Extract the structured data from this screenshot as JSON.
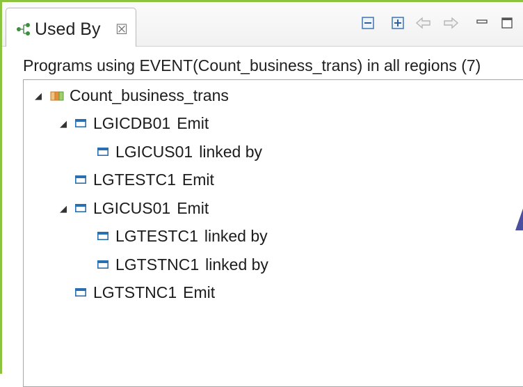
{
  "tab": {
    "icon": "hierarchy-icon",
    "label": "Used By",
    "close_icon": "close-icon",
    "close_glyph": "☒"
  },
  "toolbar": [
    {
      "icon": "collapse-all-icon"
    },
    {
      "icon": "expand-all-icon"
    },
    {
      "icon": "back-arrow-icon"
    },
    {
      "icon": "forward-arrow-icon"
    },
    {
      "icon": "minimize-icon"
    },
    {
      "icon": "maximize-icon"
    }
  ],
  "header": "Programs using EVENT(Count_business_trans) in all regions (7)",
  "tree": {
    "root": {
      "label": "Count_business_trans",
      "icon": "event-icon",
      "expanded": true
    },
    "nodes": [
      {
        "name": "LGICDB01",
        "relation": "Emit",
        "level": 1,
        "expanded": true
      },
      {
        "name": "LGICUS01",
        "relation": "linked by",
        "level": 2
      },
      {
        "name": "LGTESTC1",
        "relation": "Emit",
        "level": 1
      },
      {
        "name": "LGICUS01",
        "relation": "Emit",
        "level": 1,
        "expanded": true
      },
      {
        "name": "LGTESTC1",
        "relation": "linked by",
        "level": 2
      },
      {
        "name": "LGTSTNC1",
        "relation": "linked by",
        "level": 2
      },
      {
        "name": "LGTSTNC1",
        "relation": "Emit",
        "level": 1
      }
    ]
  },
  "colors": {
    "frame_border": "#8cc43f",
    "program_icon": "#2a6fb0",
    "event_icon": "#e0903a",
    "toolbar_icon": "#4a7db5"
  }
}
